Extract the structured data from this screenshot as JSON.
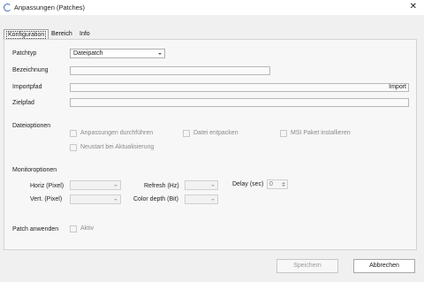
{
  "window": {
    "title": "Anpassungen (Patches)",
    "close_glyph": "✕"
  },
  "tabs": [
    {
      "label": "Konfiguration",
      "active": true
    },
    {
      "label": "Bereich",
      "active": false
    },
    {
      "label": "Info",
      "active": false
    }
  ],
  "form": {
    "patchtyp_label": "Patchtyp",
    "patchtyp_value": "Dateipatch",
    "bezeichnung_label": "Bezeichnung",
    "bezeichnung_value": "",
    "importpfad_label": "Importpfad",
    "importpfad_value": "",
    "import_button": "Import",
    "zielpfad_label": "Zielpfad",
    "zielpfad_value": ""
  },
  "dateioptionen": {
    "heading": "Dateioptionen",
    "options": [
      {
        "label": "Anpassungen durchführen",
        "checked": false
      },
      {
        "label": "Datei entpacken",
        "checked": false
      },
      {
        "label": "MSI Paket installieren",
        "checked": false
      },
      {
        "label": "Neustart bei Aktualisierung",
        "checked": false
      }
    ]
  },
  "monitoroptionen": {
    "heading": "Monitoroptionen",
    "horiz_label": "Horiz (Pixel)",
    "vert_label": "Vert. (Pixel)",
    "refresh_label": "Refresh (Hz)",
    "color_depth_label": "Color depth (Bit)",
    "delay_label": "Delay (sec)",
    "delay_value": "0"
  },
  "patch": {
    "label": "Patch anwenden",
    "aktiv_label": "Aktiv",
    "aktiv_checked": false
  },
  "footer": {
    "save_label": "Speichern",
    "cancel_label": "Abbrechen"
  }
}
